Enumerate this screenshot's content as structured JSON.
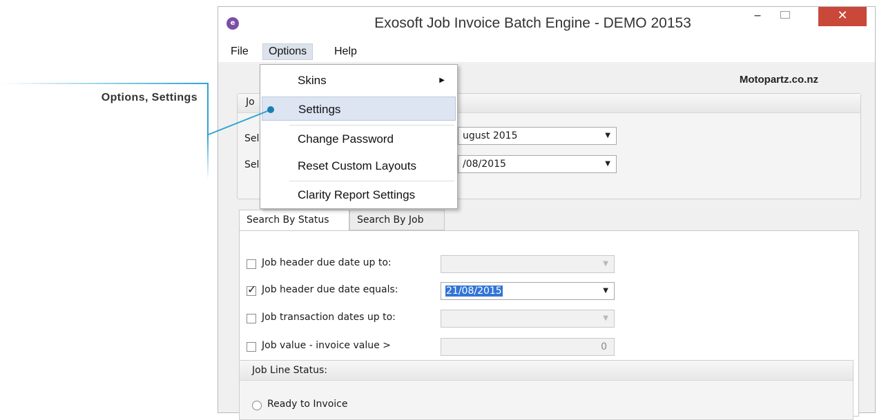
{
  "callout": {
    "label": "Options, Settings",
    "color": "#2ea3d4"
  },
  "window": {
    "title": "Exosoft Job Invoice Batch Engine - DEMO 20153",
    "close_color": "#c9483a"
  },
  "menubar": {
    "file": "File",
    "options": "Options",
    "help": "Help"
  },
  "company": "Motopartz.co.nz",
  "job_group": {
    "header": "Jo",
    "row1_label": "Sel",
    "row1_value": "ugust 2015",
    "row2_label": "Sel",
    "row2_value": "/08/2015"
  },
  "tabs": {
    "status": "Search By Status",
    "job": "Search By Job"
  },
  "filters": [
    {
      "label": "Job header due date up to:",
      "checked": false,
      "value": ""
    },
    {
      "label": "Job header due date equals:",
      "checked": true,
      "value": "21/08/2015"
    },
    {
      "label": "Job transaction dates up to:",
      "checked": false,
      "value": ""
    },
    {
      "label": "Job value - invoice value >",
      "checked": false,
      "value": "0"
    }
  ],
  "job_line_status": {
    "header": "Job Line Status:",
    "option1": "Ready to Invoice"
  },
  "options_menu": {
    "items": [
      "Skins",
      "Settings",
      "Change Password",
      "Reset Custom Layouts",
      "Clarity Report Settings"
    ],
    "highlighted": "Settings",
    "highlight_color": "#dde5f2"
  },
  "icons": {
    "app": "exosoft-app-icon",
    "submenu": "triangle-right-icon",
    "dropdown": "triangle-down-icon"
  }
}
